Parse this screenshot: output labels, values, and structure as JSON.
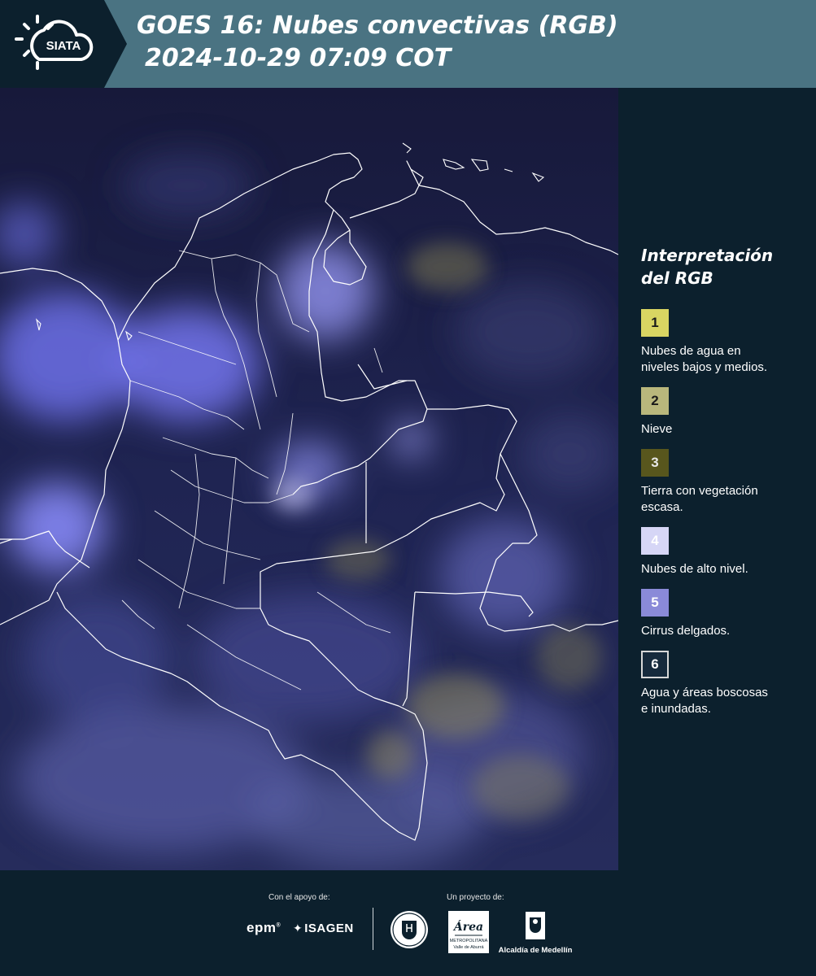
{
  "header": {
    "logo_text": "SIATA",
    "title_line_1": "GOES 16: Nubes convectivas (RGB)",
    "title_line_2": "2024-10-29 07:09 COT"
  },
  "legend": {
    "title_line_1": "Interpretación",
    "title_line_2": "del RGB",
    "items": [
      {
        "number": "1",
        "label_line_1": "Nubes de agua en",
        "label_line_2": "niveles bajos y medios.",
        "color": "#d9d562"
      },
      {
        "number": "2",
        "label_line_1": "Nieve",
        "label_line_2": "",
        "color": "#b9b77c"
      },
      {
        "number": "3",
        "label_line_1": "Tierra con vegetación",
        "label_line_2": "escasa.",
        "color": "#58561d"
      },
      {
        "number": "4",
        "label_line_1": "Nubes de alto nivel.",
        "label_line_2": "",
        "color": "#d6d6f6"
      },
      {
        "number": "5",
        "label_line_1": "Cirrus delgados.",
        "label_line_2": "",
        "color": "#8a8ad8"
      },
      {
        "number": "6",
        "label_line_1": "Agua y áreas boscosas",
        "label_line_2": "e inundadas.",
        "color": "#162a3c"
      }
    ]
  },
  "footer": {
    "support_caption": "Con el apoyo de:",
    "project_caption": "Un proyecto de:",
    "epm": "epm",
    "isagen": "ISAGEN",
    "area_line_1": "Área",
    "area_line_2": "METROPOLITANA",
    "area_line_3": "Valle de Aburrá",
    "alcaldia": "Alcaldía de Medellín"
  },
  "map": {
    "background_color": "#151c3e",
    "border_color": "#ffffff"
  }
}
